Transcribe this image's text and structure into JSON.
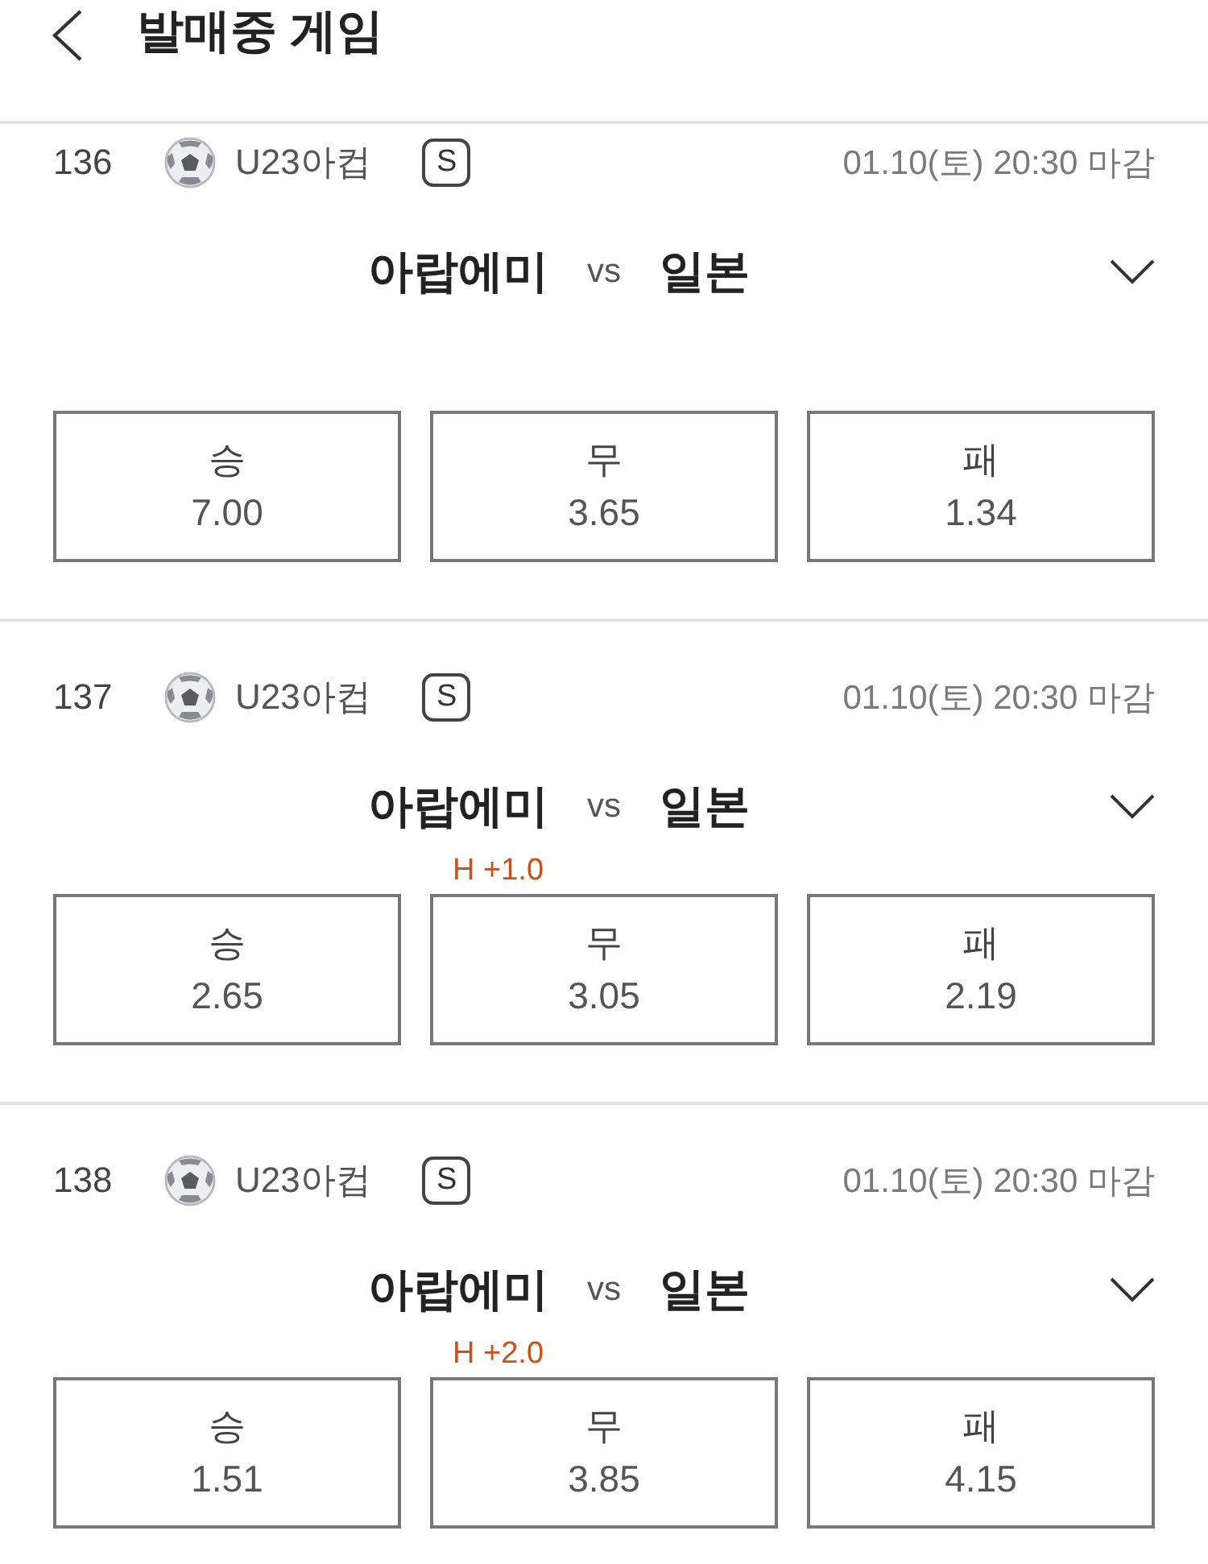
{
  "header": {
    "title": "발매중 게임"
  },
  "games": [
    {
      "number": "136",
      "league": "U23아컵",
      "badge": "S",
      "deadline": "01.10(토) 20:30 마감",
      "home": "아랍에미",
      "versus": "vs",
      "away": "일본",
      "expanded": false,
      "odds": [
        {
          "label": "승",
          "value": "7.00",
          "selected": false
        },
        {
          "label": "무",
          "value": "3.65",
          "selected": false
        },
        {
          "label": "패",
          "value": "1.34",
          "selected": false
        }
      ]
    },
    {
      "number": "137",
      "league": "U23아컵",
      "badge": "S",
      "deadline": "01.10(토) 20:30 마감",
      "home": "아랍에미",
      "versus": "vs",
      "away": "일본",
      "expanded": false,
      "handicap": "H +1.0",
      "odds": [
        {
          "label": "승",
          "value": "2.65",
          "selected": false
        },
        {
          "label": "무",
          "value": "3.05",
          "selected": false
        },
        {
          "label": "패",
          "value": "2.19",
          "selected": false
        }
      ]
    },
    {
      "number": "138",
      "league": "U23아컵",
      "badge": "S",
      "deadline": "01.10(토) 20:30 마감",
      "home": "아랍에미",
      "versus": "vs",
      "away": "일본",
      "expanded": false,
      "handicap": "H +2.0",
      "odds": [
        {
          "label": "승",
          "value": "1.51",
          "selected": false
        },
        {
          "label": "무",
          "value": "3.85",
          "selected": false
        },
        {
          "label": "패",
          "value": "4.15",
          "selected": false
        }
      ]
    }
  ]
}
